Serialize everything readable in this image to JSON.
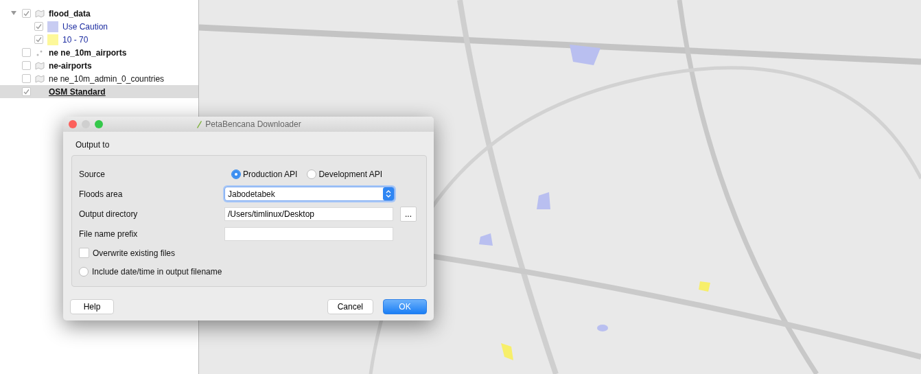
{
  "layers": [
    {
      "label": "flood_data",
      "checked": true,
      "bold": true,
      "kind": "vector",
      "expanded": true,
      "selected": false,
      "children": [
        {
          "label": "Use Caution",
          "checked": true,
          "color": "#c8ccf2"
        },
        {
          "label": "10 - 70",
          "checked": true,
          "color": "#fdf89a"
        }
      ]
    },
    {
      "label": "ne ne_10m_airports",
      "checked": false,
      "bold": true,
      "kind": "point",
      "selected": false
    },
    {
      "label": "ne-airports",
      "checked": false,
      "bold": true,
      "kind": "vector",
      "selected": false
    },
    {
      "label": "ne ne_10m_admin_0_countries",
      "checked": false,
      "bold": false,
      "kind": "vector",
      "selected": false
    },
    {
      "label": "OSM Standard",
      "checked": true,
      "bold": true,
      "kind": "raster",
      "selected": true
    }
  ],
  "dialog": {
    "title": "PetaBencana Downloader",
    "section": "Output to",
    "source": {
      "label": "Source",
      "options": [
        {
          "label": "Production API",
          "selected": true
        },
        {
          "label": "Development API",
          "selected": false
        }
      ]
    },
    "fields": [
      {
        "label": "Floods area",
        "kind": "select",
        "value": "Jabodetabek"
      },
      {
        "label": "Output directory",
        "kind": "path",
        "value": "/Users/timlinux/Desktop",
        "browse": "..."
      },
      {
        "label": "File name prefix",
        "kind": "text"
      }
    ],
    "options": [
      {
        "label": "Overwrite existing files",
        "kind": "checkbox",
        "checked": false
      },
      {
        "label": "Include date/time in output filename",
        "kind": "round",
        "checked": false
      }
    ],
    "buttons": [
      {
        "label": "Help",
        "kind": "help",
        "default": false
      },
      {
        "label": "Cancel",
        "kind": "action",
        "default": false
      },
      {
        "label": "OK",
        "kind": "action",
        "default": true
      }
    ]
  }
}
